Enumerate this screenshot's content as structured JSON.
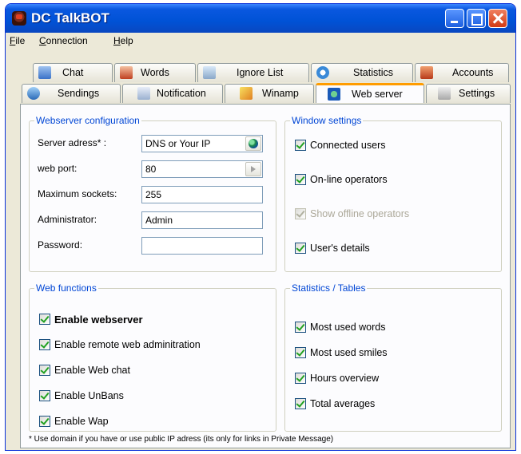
{
  "window": {
    "title": "DC TalkBOT"
  },
  "menu": [
    {
      "label": "File",
      "accel": "F"
    },
    {
      "label": "Connection",
      "accel": "C"
    },
    {
      "label": "Help",
      "accel": "H"
    }
  ],
  "tabs_row1": [
    {
      "label": "Chat",
      "icon": "chat-icon"
    },
    {
      "label": "Words",
      "icon": "words-icon"
    },
    {
      "label": "Ignore List",
      "icon": "ignore-list-icon"
    },
    {
      "label": "Statistics",
      "icon": "statistics-icon"
    },
    {
      "label": "Accounts",
      "icon": "accounts-icon"
    }
  ],
  "tabs_row2": [
    {
      "label": "Sendings",
      "icon": "sendings-icon"
    },
    {
      "label": "Notification",
      "icon": "notification-icon"
    },
    {
      "label": "Winamp",
      "icon": "winamp-icon"
    },
    {
      "label": "Web server",
      "icon": "web-server-icon",
      "active": true
    },
    {
      "label": "Settings",
      "icon": "settings-icon"
    }
  ],
  "webserver_config": {
    "title": "Webserver configuration",
    "server_address_label": "Server adress* :",
    "server_address_value": "DNS or Your IP",
    "web_port_label": "web port:",
    "web_port_value": "80",
    "max_sockets_label": "Maximum sockets:",
    "max_sockets_value": "255",
    "administrator_label": "Administrator:",
    "administrator_value": "Admin",
    "password_label": "Password:",
    "password_value": ""
  },
  "window_settings": {
    "title": "Window settings",
    "items": [
      {
        "label": "Connected users",
        "checked": true,
        "enabled": true
      },
      {
        "label": "On-line operators",
        "checked": true,
        "enabled": true
      },
      {
        "label": "Show offline operators",
        "checked": true,
        "enabled": false
      },
      {
        "label": "User's details",
        "checked": true,
        "enabled": true
      }
    ]
  },
  "web_functions": {
    "title": "Web functions",
    "items": [
      {
        "label": "Enable webserver",
        "checked": true
      },
      {
        "label": "Enable remote web adminitration",
        "checked": true
      },
      {
        "label": "Enable Web chat",
        "checked": true
      },
      {
        "label": "Enable UnBans",
        "checked": true
      },
      {
        "label": "Enable Wap",
        "checked": true
      }
    ]
  },
  "statistics_tables": {
    "title": "Statistics / Tables",
    "items": [
      {
        "label": "Most used words",
        "checked": true
      },
      {
        "label": "Most used smiles",
        "checked": true
      },
      {
        "label": "Hours overview",
        "checked": true
      },
      {
        "label": "Total averages",
        "checked": true
      }
    ]
  },
  "footnote": "* Use domain if you have or use public IP adress (its only for links in Private Message)"
}
